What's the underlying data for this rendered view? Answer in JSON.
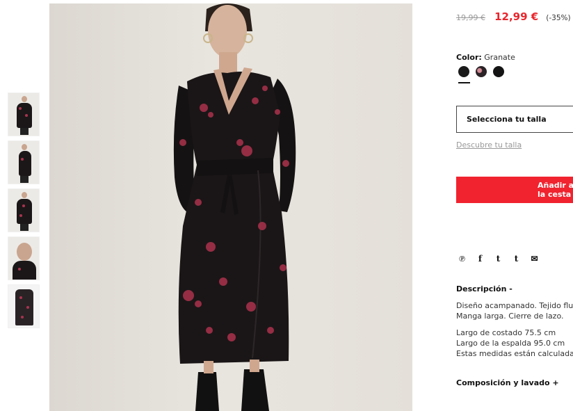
{
  "product": {
    "price_old": "19,99 €",
    "price_new": "12,99 €",
    "discount": "(-35%)",
    "color_label": "Color:",
    "color_value": "Granate",
    "swatches": [
      "black",
      "floral",
      "black-2"
    ],
    "size_placeholder": "Selecciona tu talla",
    "size_help": "Descubre tu talla",
    "add_to_cart": "Añadir a la cesta"
  },
  "share": {
    "icons": [
      "pinterest-icon",
      "facebook-icon",
      "twitter-icon",
      "tumblr-icon",
      "email-icon"
    ],
    "glyphs": [
      "℗",
      "f",
      "t",
      "t",
      "✉"
    ]
  },
  "description": {
    "title": "Descripción -",
    "line1": "Diseño acampanado. Tejido fluido",
    "line2": "Manga larga. Cierre de lazo.",
    "line3": "Largo de costado 75.5 cm",
    "line4": "Largo de la espalda 95.0 cm",
    "line5": "Estas medidas están calculadas"
  },
  "composition": {
    "title": "Composición y lavado +"
  },
  "colors": {
    "accent": "#e8262d",
    "button": "#f0232f",
    "muted": "#999999"
  }
}
